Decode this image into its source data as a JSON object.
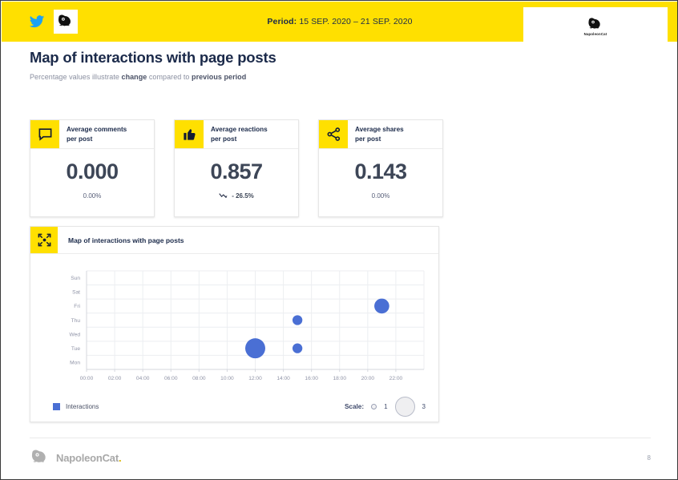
{
  "header": {
    "platform_icon": "twitter-icon",
    "brand_icon": "napoleoncat-cat-icon",
    "period_label": "Period:",
    "period_value": "15 SEP. 2020 – 21 SEP. 2020",
    "badge_name": "NapoleonCat",
    "background_color": "#FFE000"
  },
  "title": {
    "heading": "Map of interactions with page posts",
    "sub_pre": "Percentage values illustrate ",
    "sub_bold1": "change",
    "sub_mid": " compared to ",
    "sub_bold2": "previous period"
  },
  "cards": [
    {
      "icon": "comment-bubble-icon",
      "title_line1": "Average comments",
      "title_line2": "per post",
      "value": "0.000",
      "change": "0.00%",
      "trend": "flat"
    },
    {
      "icon": "thumbs-up-icon",
      "title_line1": "Average reactions",
      "title_line2": "per post",
      "value": "0.857",
      "change": "- 26.5%",
      "trend": "down"
    },
    {
      "icon": "share-nodes-icon",
      "title_line1": "Average shares",
      "title_line2": "per post",
      "value": "0.143",
      "change": "0.00%",
      "trend": "flat"
    }
  ],
  "panel": {
    "icon": "interaction-map-icon",
    "title": "Map of interactions with page posts",
    "legend_label": "Interactions",
    "legend_color": "#4a6fd4",
    "scale_label": "Scale:",
    "scale_small": "1",
    "scale_large": "3"
  },
  "chart_data": {
    "type": "scatter",
    "title": "Map of interactions with page posts",
    "xlabel": "",
    "ylabel": "",
    "grid": true,
    "legend_position": "bottom-left",
    "series_name": "Interactions",
    "series_color": "#4a6fd4",
    "y_categories": [
      "Sun",
      "Sat",
      "Fri",
      "Thu",
      "Wed",
      "Tue",
      "Mon"
    ],
    "x_ticks": [
      "00:00",
      "02:00",
      "04:00",
      "06:00",
      "08:00",
      "10:00",
      "12:00",
      "14:00",
      "16:00",
      "18:00",
      "20:00",
      "22:00"
    ],
    "xlim_hours": [
      0,
      24
    ],
    "size_scale": {
      "min_value": 1,
      "max_value": 3
    },
    "points": [
      {
        "day": "Tue",
        "time": "12:00",
        "hour": 12,
        "value": 3
      },
      {
        "day": "Thu",
        "time": "15:00",
        "hour": 15,
        "value": 1
      },
      {
        "day": "Tue",
        "time": "15:00",
        "hour": 15,
        "value": 1
      },
      {
        "day": "Fri",
        "time": "21:00",
        "hour": 21,
        "value": 2
      }
    ]
  },
  "footer": {
    "brand": "NapoleonCat",
    "brand_dot": ".",
    "page_number": "8"
  }
}
